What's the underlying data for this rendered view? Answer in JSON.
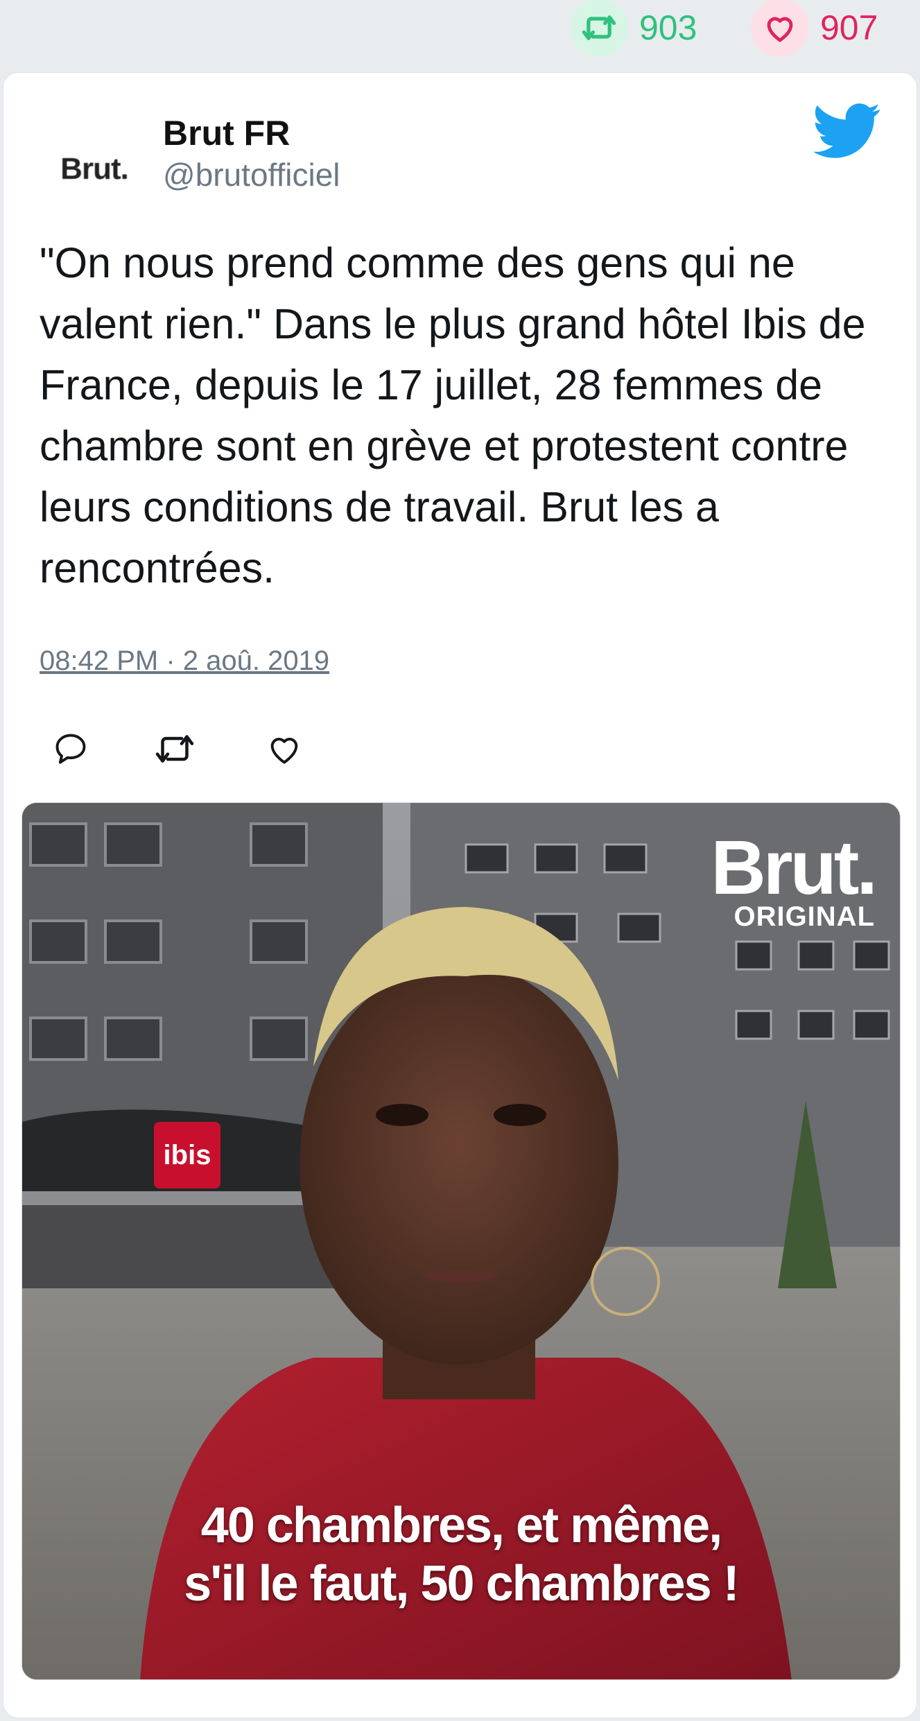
{
  "stats": {
    "retweets": "903",
    "likes": "907",
    "retweet_color": "#2ec27e",
    "like_color": "#e0245e"
  },
  "author": {
    "avatar_text": "Brut.",
    "name": "Brut FR",
    "handle": "@brutofficiel"
  },
  "tweet": {
    "text": "\"On nous prend comme des gens qui ne valent rien.\" Dans le plus grand hôtel Ibis de France, depuis le 17 juillet, 28 femmes de chambre sont en grève et protestent contre leurs conditions de travail. Brut les a rencontrées.",
    "timestamp": "08:42 PM · 2 aoû. 2019"
  },
  "actions": [
    {
      "icon": "reply-icon"
    },
    {
      "icon": "retweet-icon"
    },
    {
      "icon": "like-icon"
    }
  ],
  "media": {
    "logo_word": "Brut.",
    "logo_sub": "ORIGINAL",
    "sign_text": "ibis",
    "caption_line1": "40 chambres, et même,",
    "caption_line2": "s'il le faut, 50 chambres !"
  },
  "colors": {
    "twitter_blue": "#1da1f2",
    "text": "#14171a",
    "muted": "#6b7884"
  }
}
